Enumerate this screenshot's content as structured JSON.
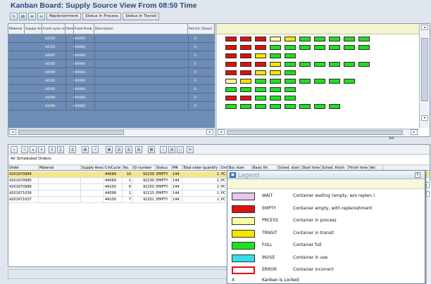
{
  "window": {
    "title": "Kanban Board: Supply Source View From 08:50 Time"
  },
  "toolbar": {
    "icons": [
      "refresh-icon",
      "document-icon",
      "zoom-in-icon",
      "zoom-out-icon"
    ],
    "buttons": [
      "Replenishment",
      "Status In Process",
      "Status In Transit"
    ]
  },
  "upper_table": {
    "columns": [
      "Material",
      "Supply Area",
      "Contr.cycle no.",
      "Item",
      "Fixed Kanb. Qty",
      "Description",
      "Pull Int. [Days]"
    ],
    "rows": [
      {
        "cycle": "44100",
        "item": "000000",
        "pull": "0"
      },
      {
        "cycle": "44103",
        "item": "000000",
        "pull": "0"
      },
      {
        "cycle": "44097",
        "item": "000000",
        "pull": "0"
      },
      {
        "cycle": "44102",
        "item": "000000",
        "pull": "0"
      },
      {
        "cycle": "44099",
        "item": "000000",
        "pull": "0"
      },
      {
        "cycle": "44101",
        "item": "000000",
        "pull": "0"
      },
      {
        "cycle": "44095",
        "item": "000000",
        "pull": "0"
      },
      {
        "cycle": "44098",
        "item": "000000",
        "pull": "0"
      },
      {
        "cycle": "44096",
        "item": "000000",
        "pull": "0"
      }
    ]
  },
  "kanban_colors": {
    "empty": "#e01010",
    "process": "#fbfba0",
    "transit": "#f5e600",
    "full": "#1ee01e",
    "wait": "#e8c6ea"
  },
  "kanban_grid": [
    [
      "empty",
      "empty",
      "empty",
      "process",
      "transit",
      "full",
      "full",
      "full",
      "full",
      "full"
    ],
    [
      "empty",
      "empty",
      "empty",
      "full",
      "full",
      "full",
      "full",
      "full",
      "full",
      "full"
    ],
    [
      "empty",
      "empty",
      "transit",
      "full",
      "full"
    ],
    [
      "empty",
      "empty",
      "empty",
      "transit",
      "full",
      "full",
      "full",
      "full",
      "full",
      "full"
    ],
    [
      "empty",
      "empty",
      "transit",
      "transit",
      "full"
    ],
    [
      "process",
      "transit",
      "full",
      "full",
      "full",
      "full",
      "full",
      "full",
      "full"
    ],
    [
      "full",
      "full",
      "full",
      "full",
      "full"
    ],
    [
      "empty",
      "empty",
      "full",
      "full",
      "full"
    ],
    [
      "full",
      "full",
      "full",
      "full",
      "full",
      "full",
      "full",
      "full"
    ]
  ],
  "status_bar": {
    "sel": "Sel"
  },
  "lower": {
    "section_title": "All Scheduled Orders",
    "columns": [
      "Order",
      "Material",
      "Supply Area",
      "CntCycle",
      "No.",
      "ID number",
      "Status",
      "MR",
      "Total order quantity",
      "Unit",
      "Bsc start",
      "Basic fin.",
      "Sched. start",
      "Start time",
      "Sched. finish",
      "Finish time",
      "Ver."
    ],
    "rows": [
      {
        "order": "4201670984",
        "cycle": "44099",
        "no": "10",
        "id": "92239",
        "status": "EMPTY",
        "mr": "144",
        "qty": "1",
        "unit": "PC"
      },
      {
        "order": "4201670985",
        "cycle": "44099",
        "no": "1",
        "id": "92230",
        "status": "EMPTY",
        "mr": "144",
        "qty": "1",
        "unit": "PC"
      },
      {
        "order": "4201670986",
        "cycle": "44100",
        "no": "6",
        "id": "92250",
        "status": "EMPTY",
        "mr": "144",
        "qty": "1",
        "unit": "PC"
      },
      {
        "order": "4201671036",
        "cycle": "44098",
        "no": "1",
        "id": "92215",
        "status": "EMPTY",
        "mr": "144",
        "qty": "1",
        "unit": "PC"
      },
      {
        "order": "4201671037",
        "cycle": "44100",
        "no": "7",
        "id": "92251",
        "status": "EMPTY",
        "mr": "144",
        "qty": "1",
        "unit": "PC"
      }
    ]
  },
  "legend": {
    "title": "Legend",
    "items": [
      {
        "code": "WAIT",
        "desc": "Container waiting (empty, w/o replen.)",
        "color": "#e8c6ea",
        "border": "#333333"
      },
      {
        "code": "EMPTY",
        "desc": "Container empty, with replenishment",
        "color": "#e01010",
        "border": "#333333"
      },
      {
        "code": "PRCESS",
        "desc": "Container in process",
        "color": "#fbfba0",
        "border": "#333333"
      },
      {
        "code": "TRNSIT",
        "desc": "Container in transit",
        "color": "#f5e600",
        "border": "#333333"
      },
      {
        "code": "FULL",
        "desc": "Container full",
        "color": "#1ee01e",
        "border": "#333333"
      },
      {
        "code": "INUSE",
        "desc": "Container in use",
        "color": "#34e0e6",
        "border": "#333333"
      },
      {
        "code": "ERROR",
        "desc": "Container incorrect",
        "color": "#ffffff",
        "border": "#e01010"
      }
    ],
    "lock_symbol": "X",
    "lock_desc": "Kanban is Locked"
  }
}
